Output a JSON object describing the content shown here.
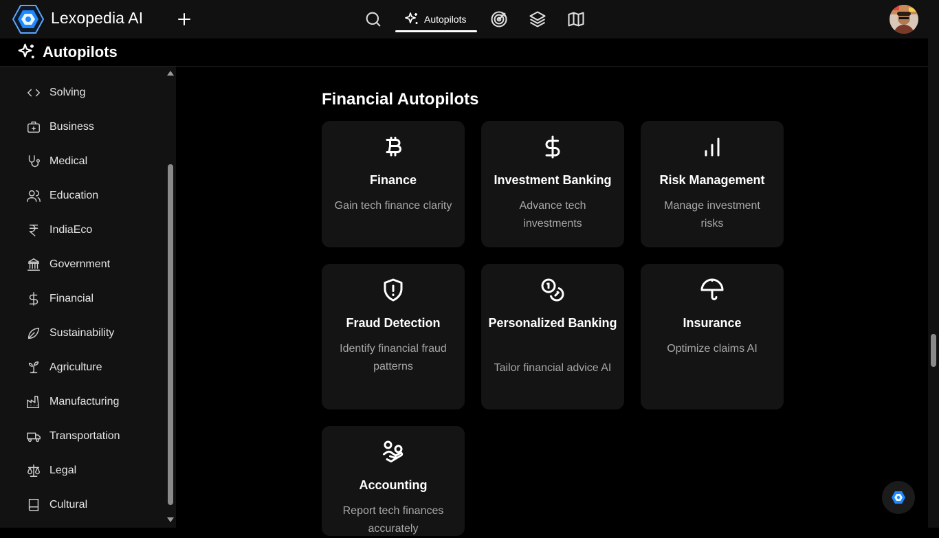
{
  "header": {
    "app_title": "Lexopedia AI",
    "active_tab_label": "Autopilots",
    "nav_icons": [
      "search-icon",
      "sparkles-icon",
      "target-icon",
      "layers-icon",
      "map-icon"
    ]
  },
  "subheader": {
    "title": "Autopilots"
  },
  "sidebar": {
    "items": [
      {
        "label": "Solving",
        "icon": "code-icon"
      },
      {
        "label": "Business",
        "icon": "briefcase-medical-icon"
      },
      {
        "label": "Medical",
        "icon": "stethoscope-icon"
      },
      {
        "label": "Education",
        "icon": "users-icon"
      },
      {
        "label": "IndiaEco",
        "icon": "rupee-icon"
      },
      {
        "label": "Government",
        "icon": "landmark-icon"
      },
      {
        "label": "Financial",
        "icon": "dollar-icon"
      },
      {
        "label": "Sustainability",
        "icon": "leaf-icon"
      },
      {
        "label": "Agriculture",
        "icon": "sprout-icon"
      },
      {
        "label": "Manufacturing",
        "icon": "factory-icon"
      },
      {
        "label": "Transportation",
        "icon": "truck-icon"
      },
      {
        "label": "Legal",
        "icon": "scale-icon"
      },
      {
        "label": "Cultural",
        "icon": "book-icon"
      }
    ]
  },
  "main": {
    "section_title": "Financial Autopilots",
    "cards": [
      {
        "title": "Finance",
        "desc": "Gain tech finance clarity",
        "icon": "bitcoin-icon"
      },
      {
        "title": "Investment Banking",
        "desc": "Advance tech investments",
        "icon": "dollar-sign-icon"
      },
      {
        "title": "Risk Management",
        "desc": "Manage investment risks",
        "icon": "bar-chart-icon"
      },
      {
        "title": "Fraud Detection",
        "desc": "Identify financial fraud patterns",
        "icon": "shield-alert-icon"
      },
      {
        "title": "Personalized Banking",
        "desc": "Tailor financial advice AI",
        "icon": "coins-icon"
      },
      {
        "title": "Insurance",
        "desc": "Optimize claims AI",
        "icon": "umbrella-icon"
      },
      {
        "title": "Accounting",
        "desc": "Report tech finances accurately",
        "icon": "hand-coins-icon"
      }
    ]
  },
  "colors": {
    "background": "#000000",
    "topbar": "#111111",
    "sidebar": "#121212",
    "card": "#141414",
    "muted_text": "#a8a8a8"
  }
}
